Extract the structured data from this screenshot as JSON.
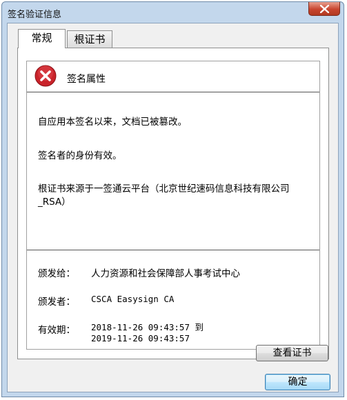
{
  "window": {
    "title": "签名验证信息",
    "close_icon": "close-icon"
  },
  "tabs": [
    {
      "label": "常规",
      "active": true
    },
    {
      "label": "根证书",
      "active": false
    }
  ],
  "signature": {
    "status_icon": "error-icon",
    "header_label": "签名属性",
    "messages": [
      "自应用本签名以来，文档已被篡改。",
      "签名者的身份有效。",
      "根证书来源于一签通云平台（北京世纪速码信息科技有限公司_RSA）"
    ]
  },
  "certificate": {
    "issued_to_label": "颁发给：",
    "issued_to": "人力资源和社会保障部人事考试中心",
    "issuer_label": "颁发者：",
    "issuer": "CSCA Easysign CA",
    "validity_label": "有效期：",
    "valid_from": "2018-11-26 09:43:57 到",
    "valid_to": "2019-11-26 09:43:57"
  },
  "buttons": {
    "view_cert": "查看证书",
    "ok": "确定"
  },
  "colors": {
    "titlebar": "#c3d7ec",
    "close_button": "#c8452f",
    "error_icon": "#c9232a"
  }
}
